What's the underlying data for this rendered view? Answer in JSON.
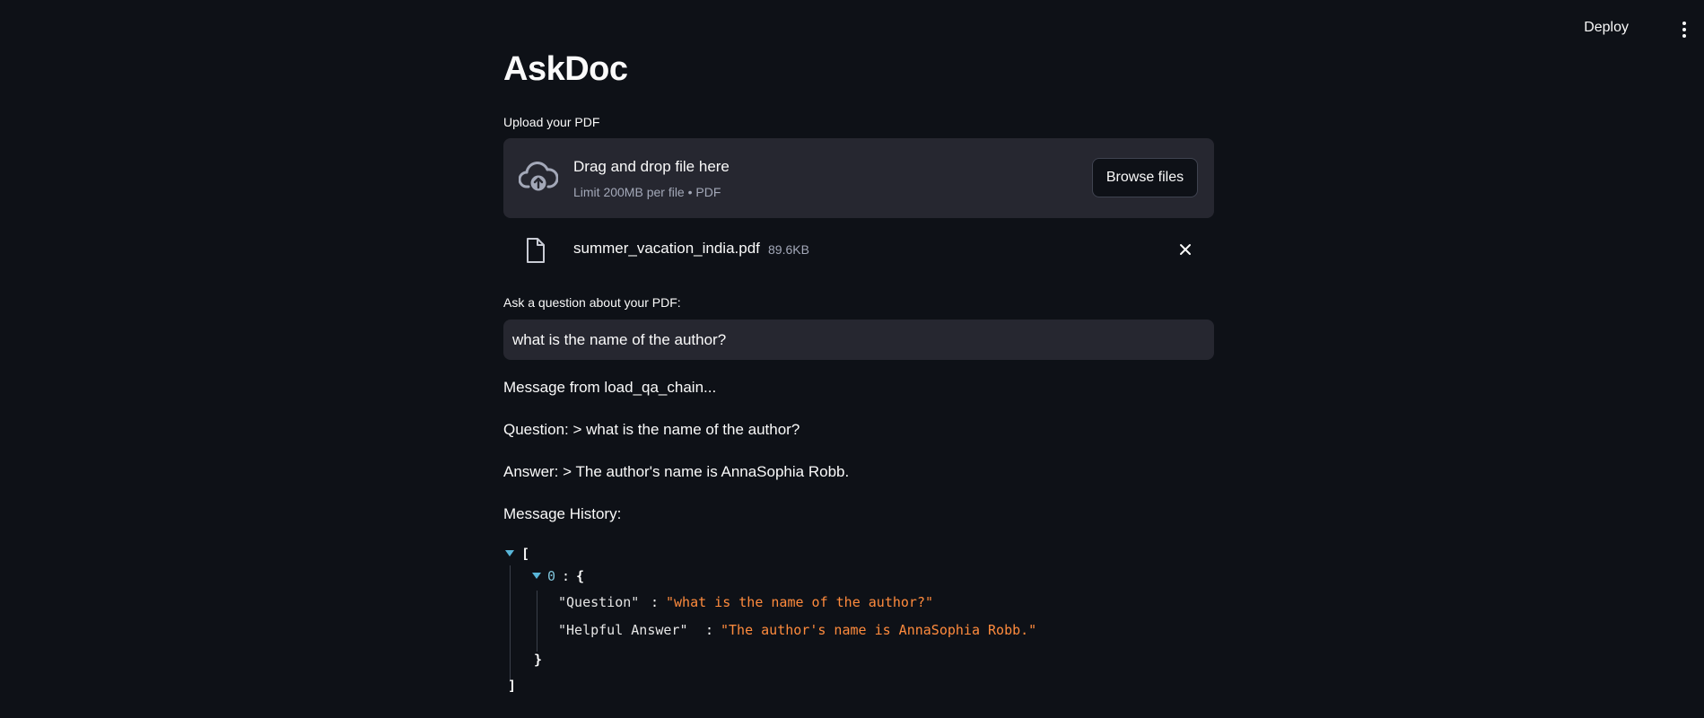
{
  "header": {
    "deploy_label": "Deploy",
    "menu_icon": "kebab-vertical-icon"
  },
  "page": {
    "title": "AskDoc"
  },
  "uploader": {
    "label": "Upload your PDF",
    "drop_title": "Drag and drop file here",
    "drop_subtitle": "Limit 200MB per file • PDF",
    "browse_label": "Browse files",
    "icon": "cloud-upload-icon"
  },
  "uploaded_file": {
    "name": "summer_vacation_india.pdf",
    "size": "89.6KB",
    "icon": "file-icon",
    "remove_icon": "close-icon"
  },
  "question_input": {
    "label": "Ask a question about your PDF:",
    "value": "what is the name of the author?"
  },
  "output": {
    "message_line": "Message from load_qa_chain...",
    "question_line": "Question: > what is the name of the author?",
    "answer_line": "Answer: > The author's name is AnnaSophia Robb.",
    "history_label": "Message History:"
  },
  "history_json": {
    "open_bracket": "[",
    "close_bracket": "]",
    "item_index": "0",
    "colon": ":",
    "open_brace": "{",
    "close_brace": "}",
    "entries": [
      {
        "key": "\"Question\"",
        "value": "\"what is the name of the author?\""
      },
      {
        "key": "\"Helpful Answer\"",
        "value": "\"The author's name is AnnaSophia Robb.\""
      }
    ]
  },
  "colors": {
    "background": "#0e1117",
    "surface": "#262730",
    "json_string": "#ff8b3d",
    "json_toggle": "#59b6d9"
  }
}
